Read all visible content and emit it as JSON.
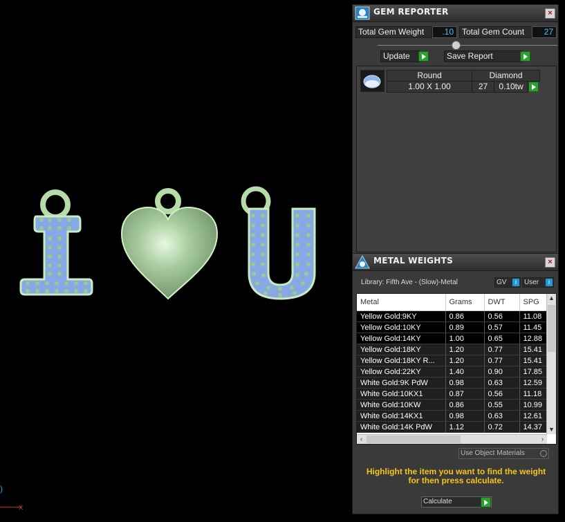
{
  "gem_reporter": {
    "title": "GEM REPORTER",
    "close": "×",
    "total_weight_label": "Total Gem Weight",
    "total_weight_value": ".10",
    "total_count_label": "Total Gem Count",
    "total_count_value": "27",
    "update_label": "Update",
    "save_report_label": "Save Report",
    "gem": {
      "shape": "Round",
      "type": "Diamond",
      "size": "1.00 X 1.00",
      "count": "27",
      "weight": "0.10tw"
    }
  },
  "metal_weights": {
    "title": "METAL WEIGHTS",
    "close": "×",
    "library": "Library: Fifth Ave - (Slow)-Metal",
    "toggle_gv": "GV",
    "toggle_user": "User",
    "toggle_check": "i",
    "columns": [
      "Metal",
      "Grams",
      "DWT",
      "SPG"
    ],
    "rows": [
      [
        "Yellow Gold:9KY",
        "0.86",
        "0.56",
        "11.08"
      ],
      [
        "Yellow Gold:10KY",
        "0.89",
        "0.57",
        "11.45"
      ],
      [
        "Yellow Gold:14KY",
        "1.00",
        "0.65",
        "12.88"
      ],
      [
        "Yellow Gold:18KY",
        "1.20",
        "0.77",
        "15.41"
      ],
      [
        "Yellow Gold:18KY R...",
        "1.20",
        "0.77",
        "15.41"
      ],
      [
        "Yellow Gold:22KY",
        "1.40",
        "0.90",
        "17.85"
      ],
      [
        "White Gold:9K PdW",
        "0.98",
        "0.63",
        "12.59"
      ],
      [
        "White Gold:10KX1",
        "0.87",
        "0.56",
        "11.18"
      ],
      [
        "White Gold:10KW",
        "0.86",
        "0.55",
        "10.99"
      ],
      [
        "White Gold:14KX1",
        "0.98",
        "0.63",
        "12.61"
      ],
      [
        "White Gold:14K PdW",
        "1.12",
        "0.72",
        "14.37"
      ]
    ],
    "use_object_materials": "Use Object Materials",
    "hint": "Highlight the item you want to find the weight for then press calculate.",
    "calculate_label": "Calculate"
  },
  "viewport": {
    "axis_x_label": "x"
  },
  "colors": {
    "pendant_fill": "#b9e0b0",
    "pendant_stroke": "#d8f5d0",
    "stone_fill": "#7fa3e8",
    "accent_green": "#2ea02e",
    "hint_yellow": "#f5c518"
  }
}
